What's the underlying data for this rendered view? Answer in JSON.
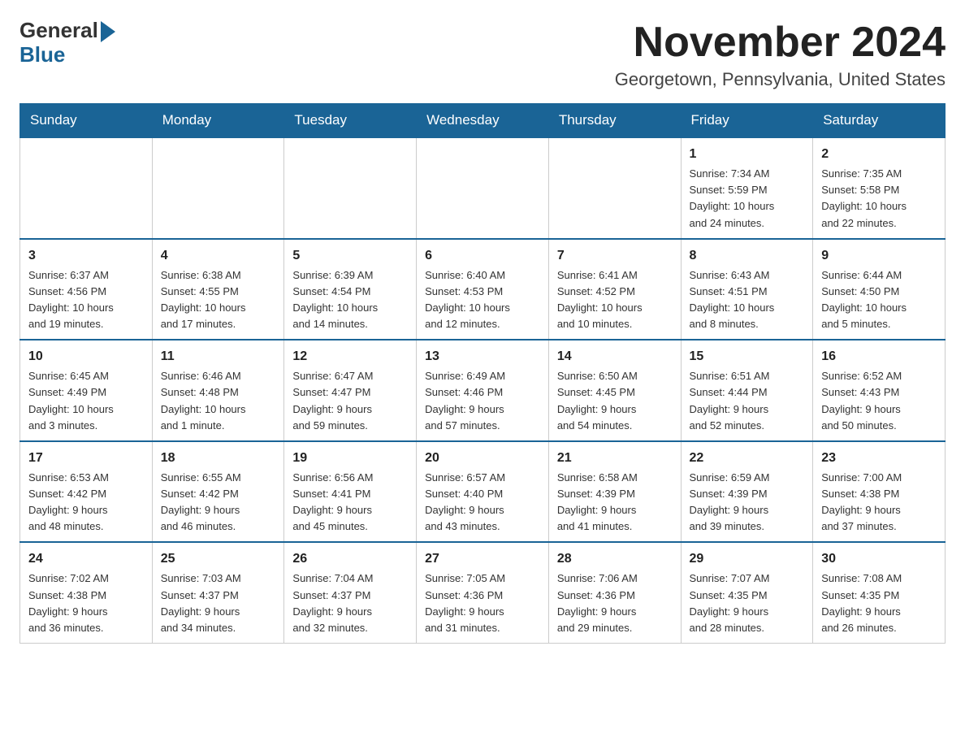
{
  "logo": {
    "general": "General",
    "blue": "Blue"
  },
  "title": {
    "month": "November 2024",
    "location": "Georgetown, Pennsylvania, United States"
  },
  "weekdays": [
    "Sunday",
    "Monday",
    "Tuesday",
    "Wednesday",
    "Thursday",
    "Friday",
    "Saturday"
  ],
  "weeks": [
    [
      {
        "day": "",
        "info": ""
      },
      {
        "day": "",
        "info": ""
      },
      {
        "day": "",
        "info": ""
      },
      {
        "day": "",
        "info": ""
      },
      {
        "day": "",
        "info": ""
      },
      {
        "day": "1",
        "info": "Sunrise: 7:34 AM\nSunset: 5:59 PM\nDaylight: 10 hours\nand 24 minutes."
      },
      {
        "day": "2",
        "info": "Sunrise: 7:35 AM\nSunset: 5:58 PM\nDaylight: 10 hours\nand 22 minutes."
      }
    ],
    [
      {
        "day": "3",
        "info": "Sunrise: 6:37 AM\nSunset: 4:56 PM\nDaylight: 10 hours\nand 19 minutes."
      },
      {
        "day": "4",
        "info": "Sunrise: 6:38 AM\nSunset: 4:55 PM\nDaylight: 10 hours\nand 17 minutes."
      },
      {
        "day": "5",
        "info": "Sunrise: 6:39 AM\nSunset: 4:54 PM\nDaylight: 10 hours\nand 14 minutes."
      },
      {
        "day": "6",
        "info": "Sunrise: 6:40 AM\nSunset: 4:53 PM\nDaylight: 10 hours\nand 12 minutes."
      },
      {
        "day": "7",
        "info": "Sunrise: 6:41 AM\nSunset: 4:52 PM\nDaylight: 10 hours\nand 10 minutes."
      },
      {
        "day": "8",
        "info": "Sunrise: 6:43 AM\nSunset: 4:51 PM\nDaylight: 10 hours\nand 8 minutes."
      },
      {
        "day": "9",
        "info": "Sunrise: 6:44 AM\nSunset: 4:50 PM\nDaylight: 10 hours\nand 5 minutes."
      }
    ],
    [
      {
        "day": "10",
        "info": "Sunrise: 6:45 AM\nSunset: 4:49 PM\nDaylight: 10 hours\nand 3 minutes."
      },
      {
        "day": "11",
        "info": "Sunrise: 6:46 AM\nSunset: 4:48 PM\nDaylight: 10 hours\nand 1 minute."
      },
      {
        "day": "12",
        "info": "Sunrise: 6:47 AM\nSunset: 4:47 PM\nDaylight: 9 hours\nand 59 minutes."
      },
      {
        "day": "13",
        "info": "Sunrise: 6:49 AM\nSunset: 4:46 PM\nDaylight: 9 hours\nand 57 minutes."
      },
      {
        "day": "14",
        "info": "Sunrise: 6:50 AM\nSunset: 4:45 PM\nDaylight: 9 hours\nand 54 minutes."
      },
      {
        "day": "15",
        "info": "Sunrise: 6:51 AM\nSunset: 4:44 PM\nDaylight: 9 hours\nand 52 minutes."
      },
      {
        "day": "16",
        "info": "Sunrise: 6:52 AM\nSunset: 4:43 PM\nDaylight: 9 hours\nand 50 minutes."
      }
    ],
    [
      {
        "day": "17",
        "info": "Sunrise: 6:53 AM\nSunset: 4:42 PM\nDaylight: 9 hours\nand 48 minutes."
      },
      {
        "day": "18",
        "info": "Sunrise: 6:55 AM\nSunset: 4:42 PM\nDaylight: 9 hours\nand 46 minutes."
      },
      {
        "day": "19",
        "info": "Sunrise: 6:56 AM\nSunset: 4:41 PM\nDaylight: 9 hours\nand 45 minutes."
      },
      {
        "day": "20",
        "info": "Sunrise: 6:57 AM\nSunset: 4:40 PM\nDaylight: 9 hours\nand 43 minutes."
      },
      {
        "day": "21",
        "info": "Sunrise: 6:58 AM\nSunset: 4:39 PM\nDaylight: 9 hours\nand 41 minutes."
      },
      {
        "day": "22",
        "info": "Sunrise: 6:59 AM\nSunset: 4:39 PM\nDaylight: 9 hours\nand 39 minutes."
      },
      {
        "day": "23",
        "info": "Sunrise: 7:00 AM\nSunset: 4:38 PM\nDaylight: 9 hours\nand 37 minutes."
      }
    ],
    [
      {
        "day": "24",
        "info": "Sunrise: 7:02 AM\nSunset: 4:38 PM\nDaylight: 9 hours\nand 36 minutes."
      },
      {
        "day": "25",
        "info": "Sunrise: 7:03 AM\nSunset: 4:37 PM\nDaylight: 9 hours\nand 34 minutes."
      },
      {
        "day": "26",
        "info": "Sunrise: 7:04 AM\nSunset: 4:37 PM\nDaylight: 9 hours\nand 32 minutes."
      },
      {
        "day": "27",
        "info": "Sunrise: 7:05 AM\nSunset: 4:36 PM\nDaylight: 9 hours\nand 31 minutes."
      },
      {
        "day": "28",
        "info": "Sunrise: 7:06 AM\nSunset: 4:36 PM\nDaylight: 9 hours\nand 29 minutes."
      },
      {
        "day": "29",
        "info": "Sunrise: 7:07 AM\nSunset: 4:35 PM\nDaylight: 9 hours\nand 28 minutes."
      },
      {
        "day": "30",
        "info": "Sunrise: 7:08 AM\nSunset: 4:35 PM\nDaylight: 9 hours\nand 26 minutes."
      }
    ]
  ]
}
